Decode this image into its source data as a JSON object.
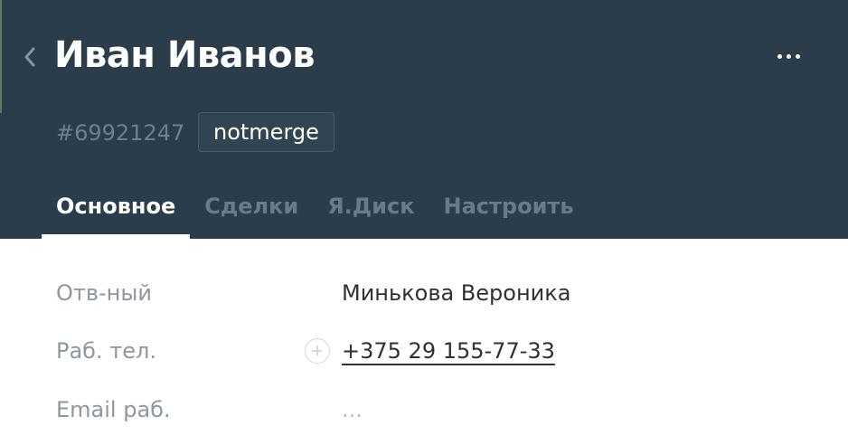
{
  "header": {
    "contact_name": "Иван Иванов",
    "contact_id": "#69921247",
    "tag": "notmerge",
    "back_icon": "chevron-left-icon",
    "more_icon": "more-horizontal-icon"
  },
  "tabs": [
    {
      "label": "Основное",
      "active": true
    },
    {
      "label": "Сделки",
      "active": false
    },
    {
      "label": "Я.Диск",
      "active": false
    },
    {
      "label": "Настроить",
      "active": false
    }
  ],
  "fields": {
    "responsible": {
      "label": "Отв-ный",
      "value": "Минькова Вероника"
    },
    "work_phone": {
      "label": "Раб. тел.",
      "value": "+375 29 155-77-33",
      "add_icon": "plus-circle-icon"
    },
    "work_email": {
      "label": "Email раб.",
      "value": "..."
    }
  },
  "colors": {
    "header_bg": "#2b3d4b",
    "tab_inactive": "#697b88",
    "label_text": "#8e979f"
  }
}
